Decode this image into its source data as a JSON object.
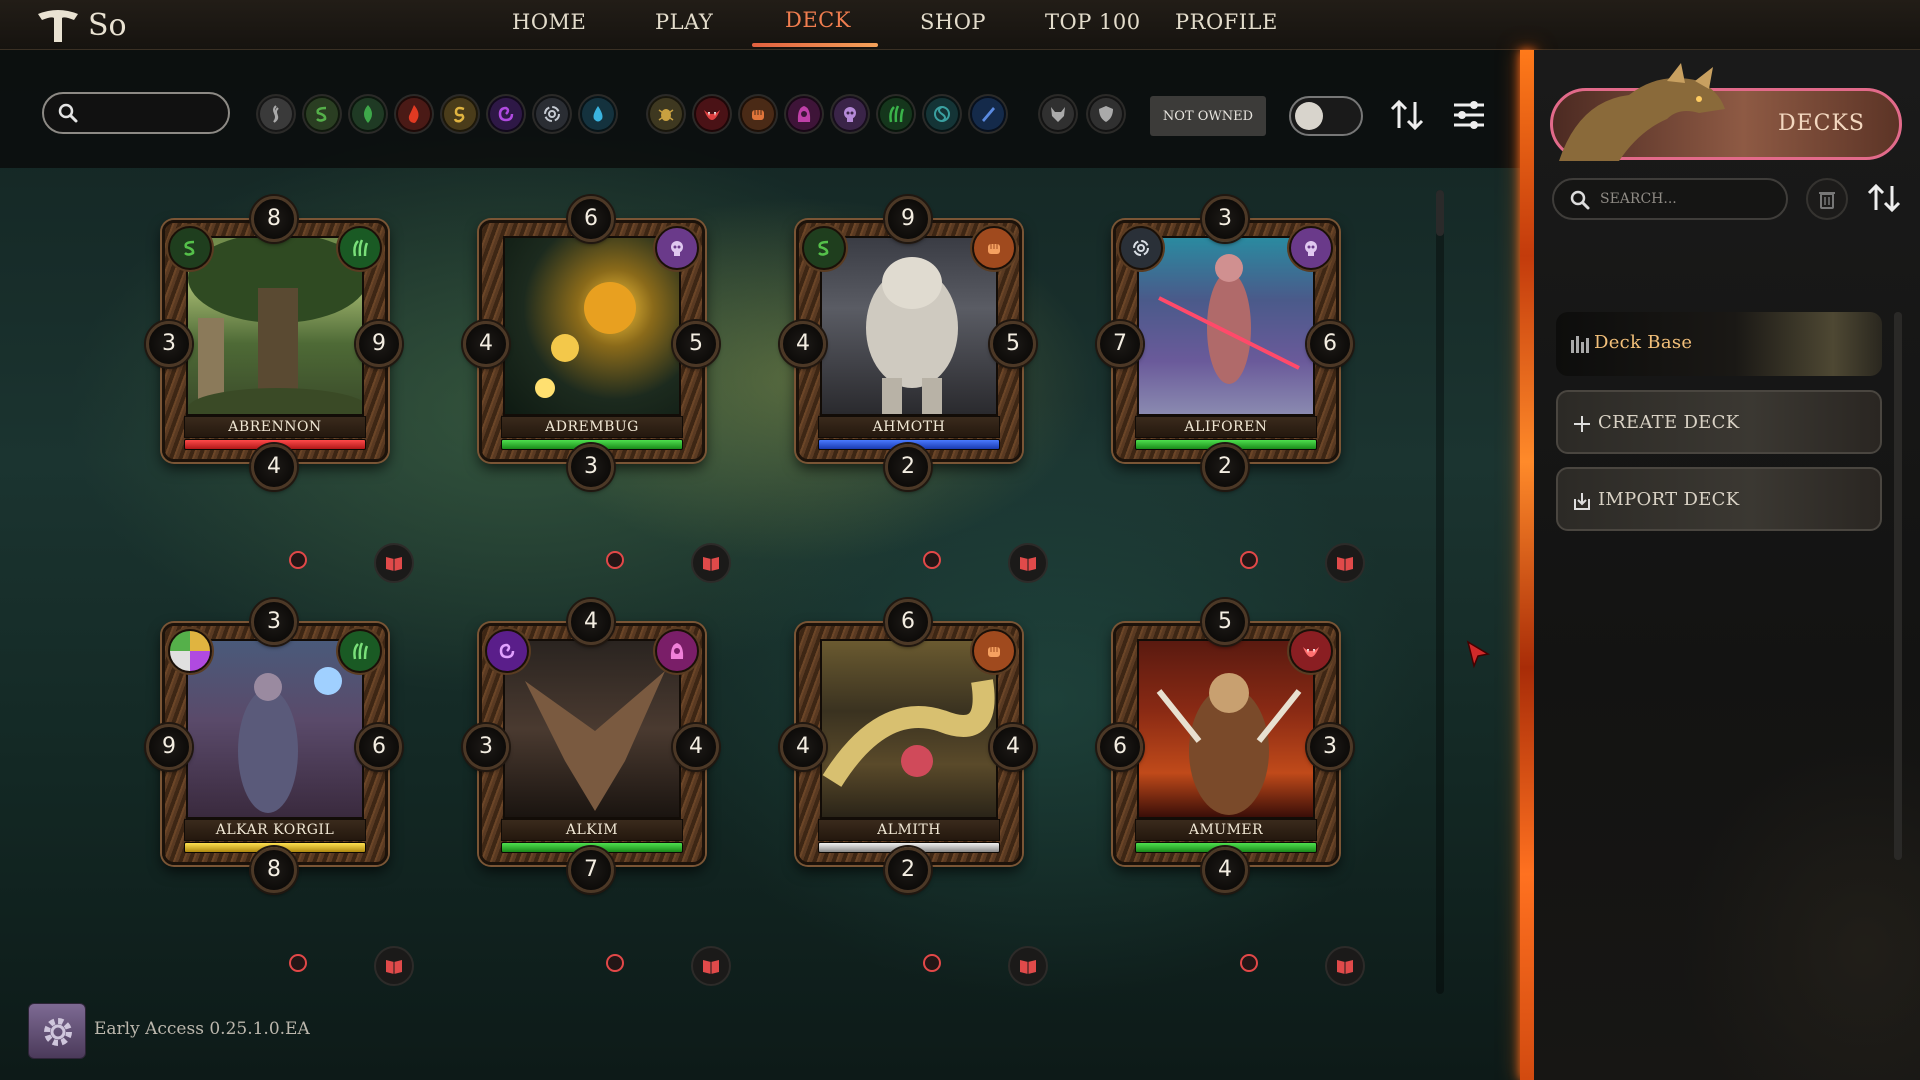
{
  "header": {
    "username": "So",
    "nav": [
      {
        "label": "HOME"
      },
      {
        "label": "PLAY"
      },
      {
        "label": "DECK"
      },
      {
        "label": "SHOP"
      },
      {
        "label": "TOP 100"
      },
      {
        "label": "PROFILE"
      }
    ],
    "active_tab": "DECK"
  },
  "filters": {
    "search": {
      "value": "",
      "placeholder": ""
    },
    "element_icons": [
      "smoke-icon",
      "money-rune-icon",
      "leaf-icon",
      "flame-icon",
      "gold-rune-icon",
      "arcane-swirl-icon",
      "vortex-icon",
      "water-drop-icon"
    ],
    "class_icons": [
      "insect-icon",
      "vampire-fangs-icon",
      "fist-icon",
      "hooded-figure-icon",
      "skull-icon",
      "claw-icon",
      "yin-yang-icon",
      "blade-icon"
    ],
    "misc_icons": [
      "beast-head-icon",
      "shield-icon"
    ],
    "not_owned_label": "NOT OWNED"
  },
  "cards": [
    {
      "name": "ABRENNON",
      "top": "8",
      "left": "3",
      "right": "9",
      "bottom": "4",
      "rarity_color": "#d62a2a",
      "corner_left": "money-rune-icon",
      "corner_right": "claw-icon"
    },
    {
      "name": "ADREMBUG",
      "top": "6",
      "left": "4",
      "right": "5",
      "bottom": "3",
      "rarity_color": "#2fb52f",
      "corner_left": "",
      "corner_right": "skull-icon"
    },
    {
      "name": "AHMOTH",
      "top": "9",
      "left": "4",
      "right": "5",
      "bottom": "2",
      "rarity_color": "#2f57d8",
      "corner_left": "money-rune-icon",
      "corner_right": "fist-icon"
    },
    {
      "name": "ALIFOREN",
      "top": "3",
      "left": "7",
      "right": "6",
      "bottom": "2",
      "rarity_color": "#2fb52f",
      "corner_left": "vortex-icon",
      "corner_right": "skull-icon"
    },
    {
      "name": "ALKAR KORGIL",
      "top": "3",
      "left": "9",
      "right": "6",
      "bottom": "8",
      "rarity_color": "#e8c42a",
      "corner_left": "multi-element-icon",
      "corner_right": "claw-icon"
    },
    {
      "name": "ALKIM",
      "top": "4",
      "left": "3",
      "right": "4",
      "bottom": "7",
      "rarity_color": "#2fb52f",
      "corner_left": "arcane-swirl-icon",
      "corner_right": "hooded-figure-icon"
    },
    {
      "name": "ALMITH",
      "top": "6",
      "left": "4",
      "right": "4",
      "bottom": "2",
      "rarity_color": "#c9c9c9",
      "corner_left": "",
      "corner_right": "fist-icon"
    },
    {
      "name": "AMUMER",
      "top": "5",
      "left": "6",
      "right": "3",
      "bottom": "4",
      "rarity_color": "#2fb52f",
      "corner_left": "",
      "corner_right": "vampire-fangs-icon"
    }
  ],
  "footer": {
    "version": "Early Access 0.25.1.0.EA"
  },
  "panel": {
    "title": "DECKS",
    "search_placeholder": "SEARCH...",
    "decks": [
      {
        "label": "Deck Base"
      },
      {
        "label": "CREATE DECK"
      },
      {
        "label": "IMPORT DECK"
      }
    ]
  },
  "colors": {
    "accent": "#f07d4f",
    "panel_border": "#e26a8a",
    "fire": "#ff7a1a"
  }
}
